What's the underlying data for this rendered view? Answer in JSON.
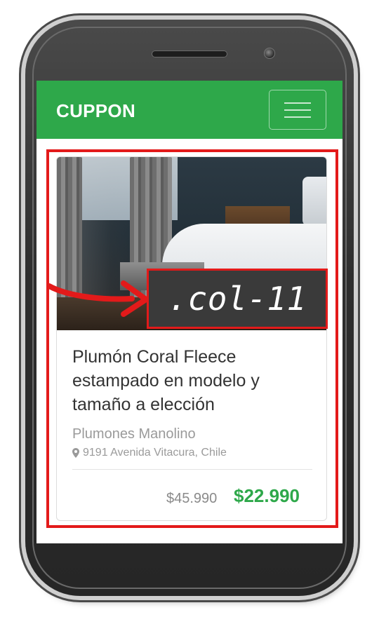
{
  "navbar": {
    "brand": "CUPPON",
    "menu_icon": "hamburger-menu-icon",
    "background_color": "#2ea84a"
  },
  "card": {
    "title": "Plumón Coral Fleece estampado en modelo y tamaño a elección",
    "vendor": "Plumones Manolino",
    "address": "9191 Avenida Vitacura, Chile",
    "address_icon": "map-pin-icon",
    "old_price": "$45.990",
    "new_price": "$22.990",
    "price_color": "#2ea84a"
  },
  "annotation": {
    "label": ".col-11",
    "highlight_color": "#e31a1a"
  }
}
